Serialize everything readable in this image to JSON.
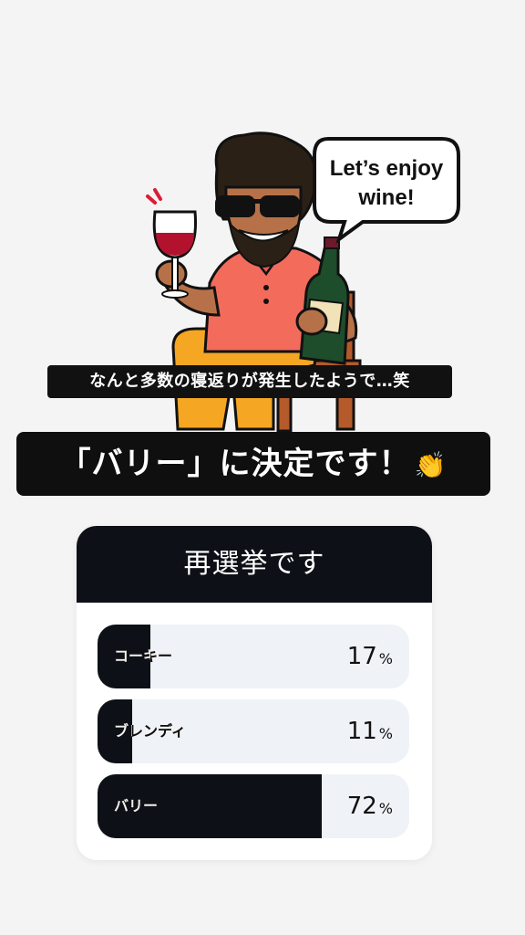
{
  "speech_bubble": "Let’s enjoy wine!",
  "caption": "なんと多数の寝返りが発生したようで…笑",
  "headline": {
    "text": "「バリー」に決定です！",
    "emoji": "👏"
  },
  "poll": {
    "title": "再選挙です",
    "options": [
      {
        "label": "コーキー",
        "percent": 17,
        "percent_text": "17",
        "sign": "%"
      },
      {
        "label": "ブレンディ",
        "percent": 11,
        "percent_text": "11",
        "sign": "%"
      },
      {
        "label": "バリー",
        "percent": 72,
        "percent_text": "72",
        "sign": "%"
      }
    ]
  },
  "colors": {
    "dark": "#0d1117",
    "bar_track": "#eff2f6",
    "shirt": "#f26b5b",
    "pants": "#f5a623",
    "chair": "#b55a2a",
    "wine": "#b3122e"
  }
}
